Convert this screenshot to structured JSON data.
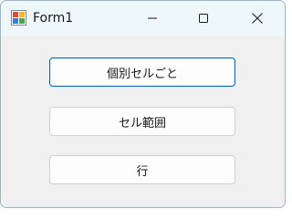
{
  "window": {
    "title": "Form1",
    "icon": "winforms-app-icon",
    "controls": {
      "minimize": "minimize-icon",
      "maximize": "maximize-icon",
      "close": "close-icon"
    }
  },
  "buttons": {
    "individual_cells": "個別セルごと",
    "cell_range": "セル範囲",
    "row": "行"
  },
  "colors": {
    "titlebar_bg": "#eef7fa",
    "client_bg": "#f0f0f0",
    "focus_border": "#0067c0"
  }
}
